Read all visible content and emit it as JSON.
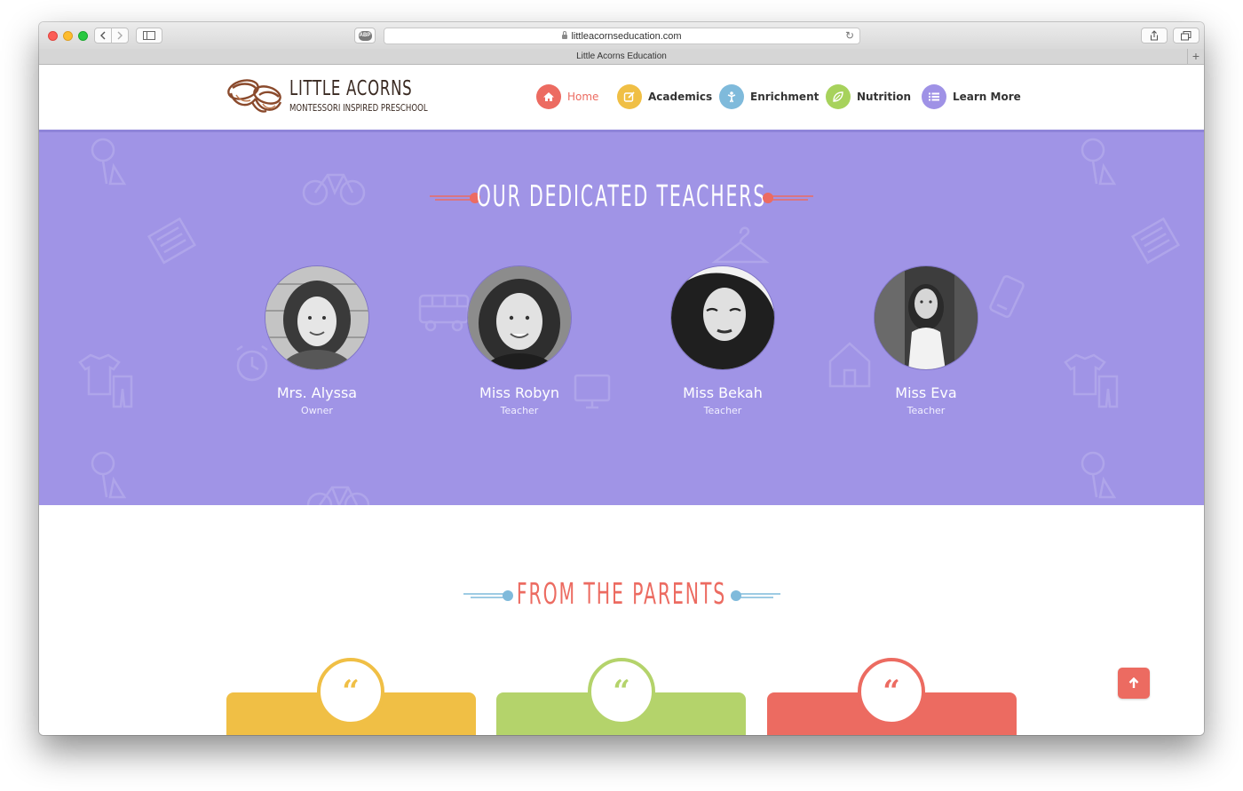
{
  "browser": {
    "url": "littleacornseducation.com",
    "tab_title": "Little Acorns Education",
    "abp_label": "ABP"
  },
  "site": {
    "logo_title": "LITTLE ACORNS",
    "logo_subtitle": "MONTESSORI INSPIRED PRESCHOOL",
    "nav": [
      {
        "label": "Home",
        "icon": "home-icon",
        "color": "#ec6b61",
        "active": true
      },
      {
        "label": "Academics",
        "icon": "pencil-square-icon",
        "color": "#f0bf45",
        "active": false
      },
      {
        "label": "Enrichment",
        "icon": "child-figure-icon",
        "color": "#7fbadb",
        "active": false
      },
      {
        "label": "Nutrition",
        "icon": "leaf-icon",
        "color": "#a7d25c",
        "active": false
      },
      {
        "label": "Learn More",
        "icon": "list-icon",
        "color": "#9f92e6",
        "active": false
      }
    ]
  },
  "teachers_section": {
    "title": "OUR DEDICATED TEACHERS",
    "background": "#a094e6",
    "accent": "#ec6b61",
    "teachers": [
      {
        "name": "Mrs. Alyssa",
        "role": "Owner"
      },
      {
        "name": "Miss Robyn",
        "role": "Teacher"
      },
      {
        "name": "Miss Bekah",
        "role": "Teacher"
      },
      {
        "name": "Miss Eva",
        "role": "Teacher"
      }
    ]
  },
  "parents_section": {
    "title": "FROM THE PARENTS",
    "title_color": "#ec6b61",
    "accent": "#7fbadb",
    "cards": [
      {
        "color": "#f0bf45",
        "quote_glyph": "“"
      },
      {
        "color": "#b4d36b",
        "quote_glyph": "“"
      },
      {
        "color": "#ec6b61",
        "quote_glyph": "“"
      }
    ]
  },
  "back_to_top": {
    "icon": "arrow-up-icon",
    "color": "#ec6b61"
  }
}
